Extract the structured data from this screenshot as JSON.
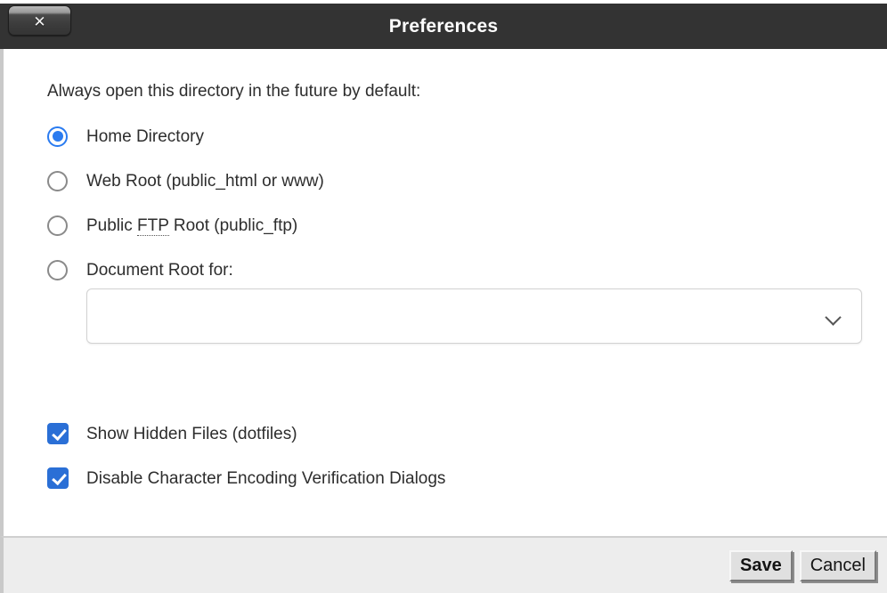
{
  "window": {
    "title": "Preferences",
    "close_label": "✕",
    "close_icon": "close-icon"
  },
  "background": {
    "sliver_text": "— — — —",
    "sliver_text_right": "— —"
  },
  "body": {
    "intro": "Always open this directory in the future by default:",
    "radio_group_name": "default-directory",
    "radios": [
      {
        "label": "Home Directory",
        "checked": true,
        "value": "home"
      },
      {
        "label": "Web Root (public_html or www)",
        "checked": false,
        "value": "webroot"
      },
      {
        "label_pre": "Public ",
        "abbr": "FTP",
        "label_post": " Root (public_ftp)",
        "checked": false,
        "value": "publicftp"
      },
      {
        "label": "Document Root for:",
        "checked": false,
        "value": "docroot"
      }
    ],
    "document_root_select": {
      "value": "",
      "placeholder": "",
      "chevron_icon": "chevron-down-icon"
    },
    "checkboxes": [
      {
        "label": "Show Hidden Files (dotfiles)",
        "checked": true
      },
      {
        "label": "Disable Character Encoding Verification Dialogs",
        "checked": true
      }
    ]
  },
  "footer": {
    "save_label": "Save",
    "cancel_label": "Cancel"
  },
  "colors": {
    "titlebar_bg": "#333333",
    "accent_blue": "#2a7bf0",
    "checkbox_blue": "#2a6fd6",
    "footer_bg": "#ededed",
    "body_bg": "#ffffff",
    "text": "#2d2d2d"
  }
}
